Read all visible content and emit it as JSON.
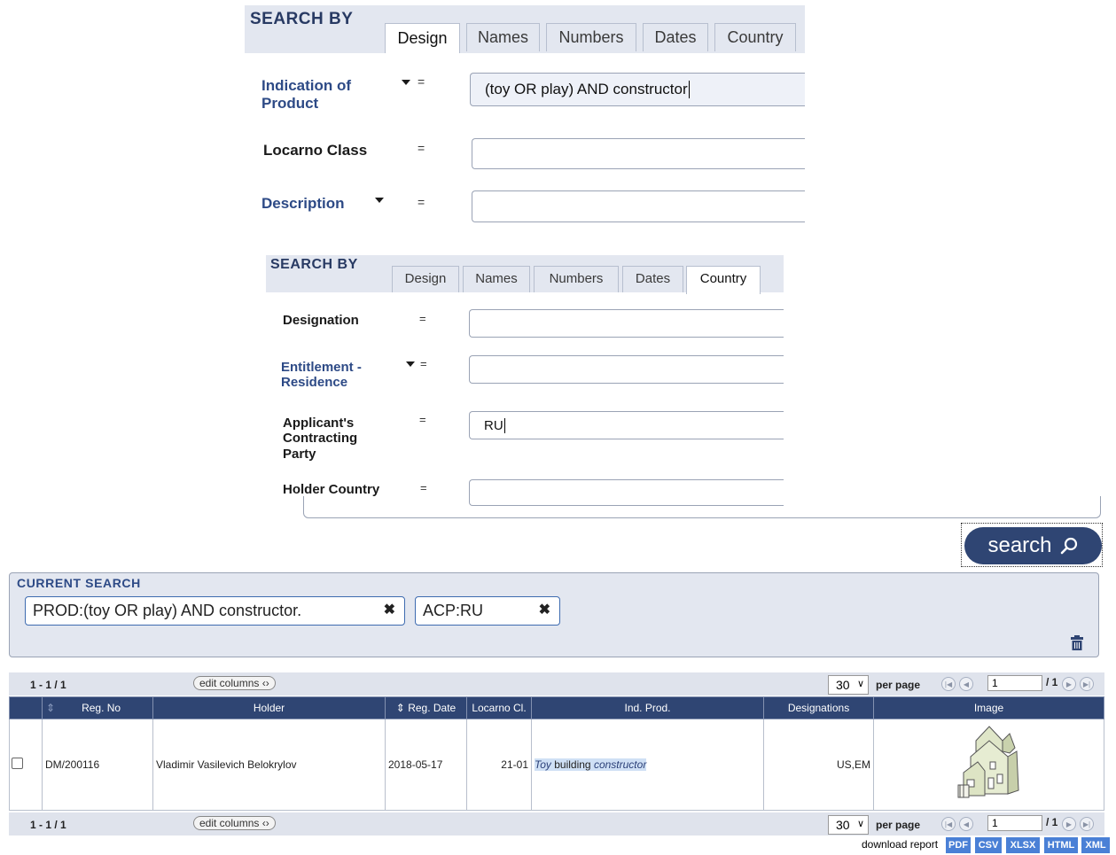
{
  "panel1": {
    "title": "SEARCH BY",
    "tabs": [
      "Design",
      "Names",
      "Numbers",
      "Dates",
      "Country"
    ],
    "active_tab": "Design",
    "fields": [
      {
        "label_line1": "Indication of",
        "label_line2": "Product",
        "operator": "=",
        "value": "(toy OR play) AND constructor"
      },
      {
        "label": "Locarno Class",
        "operator": "=",
        "value": ""
      },
      {
        "label": "Description",
        "operator": "=",
        "value": ""
      }
    ]
  },
  "panel2": {
    "title": "SEARCH BY",
    "tabs": [
      "Design",
      "Names",
      "Numbers",
      "Dates",
      "Country"
    ],
    "active_tab": "Country",
    "fields": [
      {
        "label": "Designation",
        "operator": "=",
        "value": ""
      },
      {
        "label_line1": "Entitlement -",
        "label_line2": "Residence",
        "operator": "=",
        "value": ""
      },
      {
        "label_line1": "Applicant's",
        "label_line2": "Contracting",
        "label_line3": "Party",
        "operator": "=",
        "value": "RU"
      },
      {
        "label": "Holder Country",
        "operator": "=",
        "value": ""
      }
    ]
  },
  "search_button": "search",
  "current_search": {
    "title": "CURRENT SEARCH",
    "chips": [
      "PROD:(toy OR play) AND constructor.",
      "ACP:RU"
    ]
  },
  "results": {
    "count": "1 - 1 / 1",
    "edit_columns": "edit columns",
    "per_page_value": "30",
    "per_page_label": "per page",
    "page": "1",
    "page_total": "/ 1",
    "columns": [
      "",
      "Reg. No",
      "Holder",
      "Reg. Date",
      "Locarno Cl.",
      "Ind. Prod.",
      "Designations",
      "Image"
    ],
    "rows": [
      {
        "reg_no": "DM/200116",
        "holder": "Vladimir Vasilevich Belokrylov",
        "reg_date": "2018-05-17",
        "locarno": "21-01",
        "ind_prod_parts": [
          "Toy",
          " building ",
          "constructor"
        ],
        "designations": "US,EM"
      }
    ]
  },
  "download": {
    "label": "download report",
    "formats": [
      "PDF",
      "CSV",
      "XLSX",
      "HTML",
      "XML"
    ]
  },
  "colors": {
    "navy": "#2f4573",
    "label_blue": "#2d4a86",
    "panel_bg": "#e3e7f0",
    "format_blue": "#4a80d6"
  }
}
